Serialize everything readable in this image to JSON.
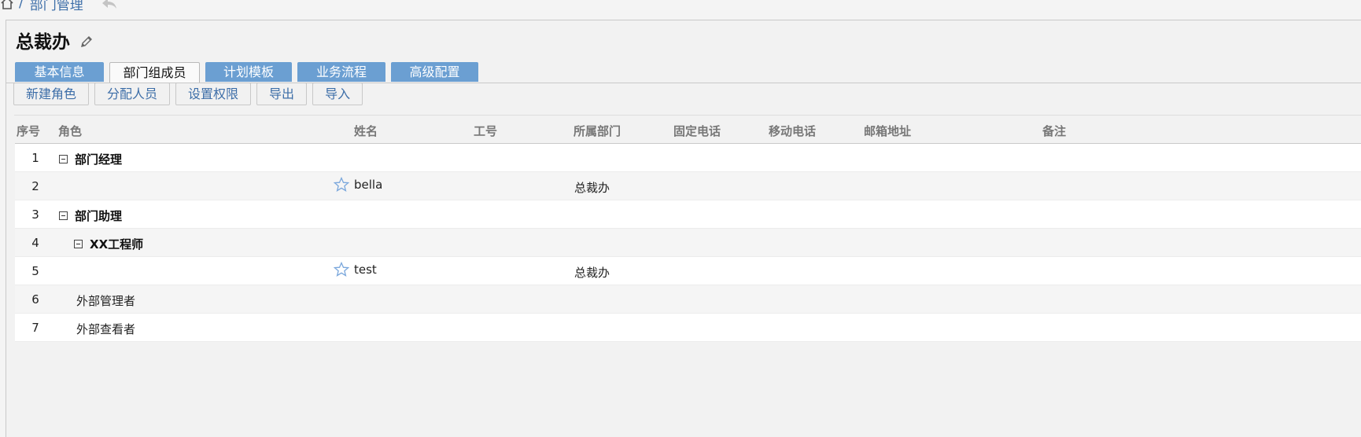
{
  "breadcrumb": {
    "separator": "/",
    "current": "部门管理"
  },
  "page": {
    "title": "总裁办"
  },
  "tabs": [
    {
      "label": "基本信息",
      "active": false
    },
    {
      "label": "部门组成员",
      "active": true
    },
    {
      "label": "计划模板",
      "active": false
    },
    {
      "label": "业务流程",
      "active": false
    },
    {
      "label": "高级配置",
      "active": false
    }
  ],
  "toolbar": {
    "new_role": "新建角色",
    "assign": "分配人员",
    "permissions": "设置权限",
    "export": "导出",
    "import": "导入"
  },
  "table": {
    "columns": {
      "index": "序号",
      "role": "角色",
      "name": "姓名",
      "emp_no": "工号",
      "dept": "所属部门",
      "phone": "固定电话",
      "mobile": "移动电话",
      "email": "邮箱地址",
      "remark": "备注"
    },
    "rows": [
      {
        "index": "1",
        "role": "部门经理",
        "name": "",
        "dept": ""
      },
      {
        "index": "2",
        "role": "",
        "name": "bella",
        "dept": "总裁办"
      },
      {
        "index": "3",
        "role": "部门助理",
        "name": "",
        "dept": ""
      },
      {
        "index": "4",
        "role": "XX工程师",
        "name": "",
        "dept": ""
      },
      {
        "index": "5",
        "role": "",
        "name": "test",
        "dept": "总裁办"
      },
      {
        "index": "6",
        "role": "外部管理者",
        "name": "",
        "dept": ""
      },
      {
        "index": "7",
        "role": "外部查看者",
        "name": "",
        "dept": ""
      }
    ]
  },
  "colors": {
    "tab_bg": "#6b9fd2",
    "link": "#3d6ea8",
    "star": "#7aa7dc"
  }
}
